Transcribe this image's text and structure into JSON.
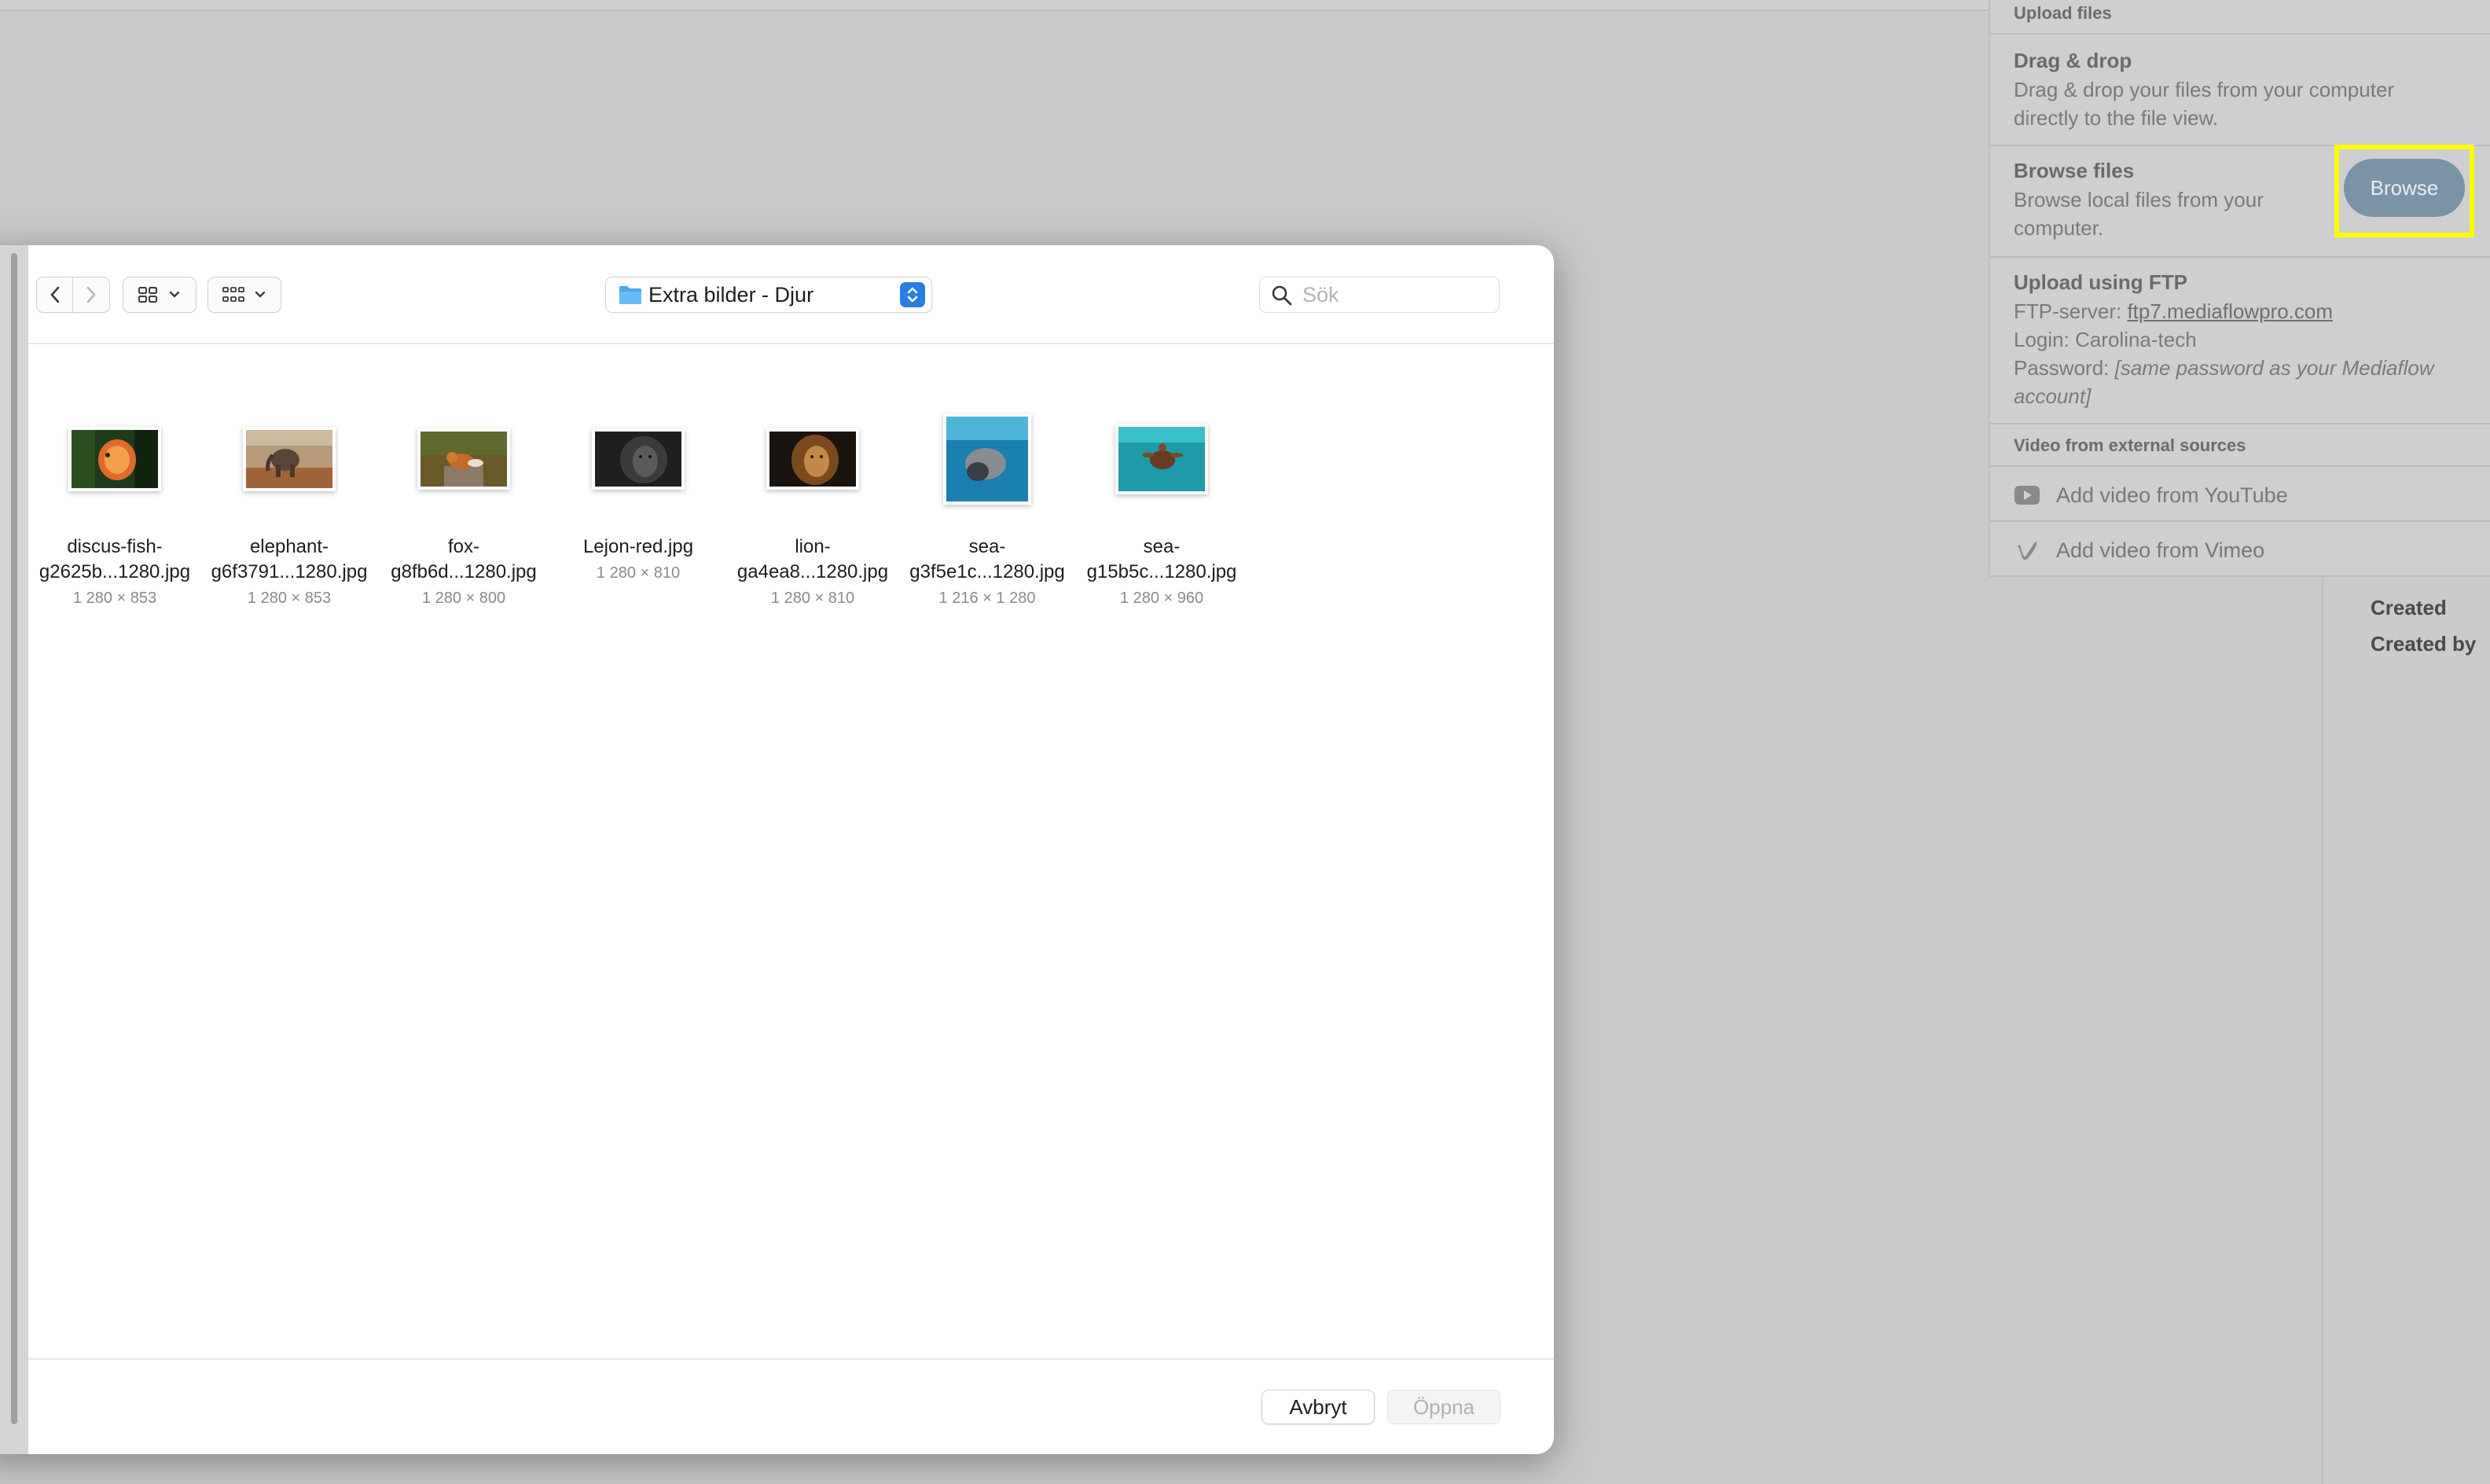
{
  "background": {
    "detail_labels": [
      "Created",
      "Created by"
    ]
  },
  "upload_panel": {
    "header": "Upload files",
    "drag_drop": {
      "title": "Drag & drop",
      "text": "Drag & drop your files from your computer directly to the file view."
    },
    "browse_files": {
      "title": "Browse files",
      "text": "Browse local files from your computer.",
      "button": "Browse"
    },
    "ftp": {
      "title": "Upload using FTP",
      "server_label": "FTP-server: ",
      "server": "ftp7.mediaflowpro.com",
      "login": "Login: Carolina-tech",
      "password_label": "Password: ",
      "password_note": "[same password as your Mediaflow account]"
    },
    "external_header": "Video from external sources",
    "youtube": "Add video from YouTube",
    "vimeo": "Add video from Vimeo"
  },
  "dialog": {
    "folder": "Extra bilder - Djur",
    "search_placeholder": "Sök",
    "files": [
      {
        "line1": "discus-fish-",
        "line2": "g2625b...1280.jpg",
        "dims": "1 280 × 853",
        "icon": "discus-fish-thumbnail"
      },
      {
        "line1": "elephant-",
        "line2": "g6f3791...1280.jpg",
        "dims": "1 280 × 853",
        "icon": "elephant-thumbnail"
      },
      {
        "line1": "fox-",
        "line2": "g8fb6d...1280.jpg",
        "dims": "1 280 × 800",
        "icon": "fox-thumbnail"
      },
      {
        "line1": "Lejon-red.jpg",
        "line2": "",
        "dims": "1 280 × 810",
        "icon": "lion-bw-thumbnail"
      },
      {
        "line1": "lion-",
        "line2": "ga4ea8...1280.jpg",
        "dims": "1 280 × 810",
        "icon": "lion-thumbnail"
      },
      {
        "line1": "sea-",
        "line2": "g3f5e1c...1280.jpg",
        "dims": "1 216 × 1 280",
        "icon": "sea-lion-thumbnail"
      },
      {
        "line1": "sea-",
        "line2": "g15b5c...1280.jpg",
        "dims": "1 280 × 960",
        "icon": "sea-turtle-thumbnail"
      }
    ],
    "cancel": "Avbryt",
    "open": "Öppna"
  },
  "colors": {
    "highlight": "#ffff00",
    "browse_button": "#7b93a6",
    "folder_stepper": "#2a7de1"
  }
}
